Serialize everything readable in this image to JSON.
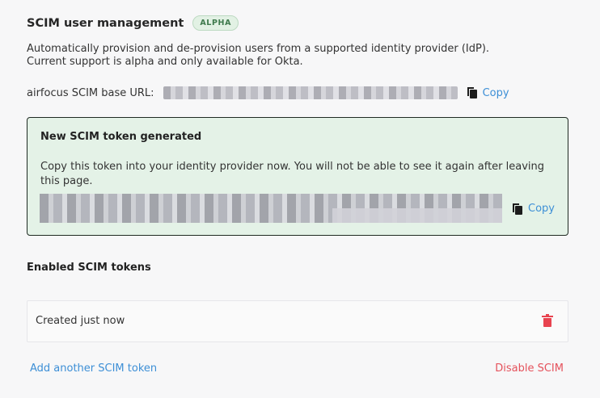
{
  "header": {
    "title": "SCIM user management",
    "badge": "ALPHA"
  },
  "description": {
    "line1": "Automatically provision and de-provision users from a supported identity provider (IdP).",
    "line2": "Current support is alpha and only available for Okta."
  },
  "base_url": {
    "label": "airfocus SCIM base URL:",
    "copy_label": "Copy"
  },
  "new_token": {
    "title": "New SCIM token generated",
    "message": "Copy this token into your identity provider now. You will not be able to see it again after leaving this page.",
    "copy_label": "Copy"
  },
  "enabled_tokens": {
    "title": "Enabled SCIM tokens",
    "items": [
      {
        "label": "Created just now"
      }
    ]
  },
  "footer": {
    "add_label": "Add another SCIM token",
    "disable_label": "Disable SCIM"
  },
  "colors": {
    "link_blue": "#3d8fd6",
    "danger_red": "#e5525c",
    "token_box_bg": "#e4f2e7",
    "badge_bg": "#e2f1e4"
  },
  "icons": {
    "copy": "copy-icon",
    "delete": "trash-icon"
  }
}
